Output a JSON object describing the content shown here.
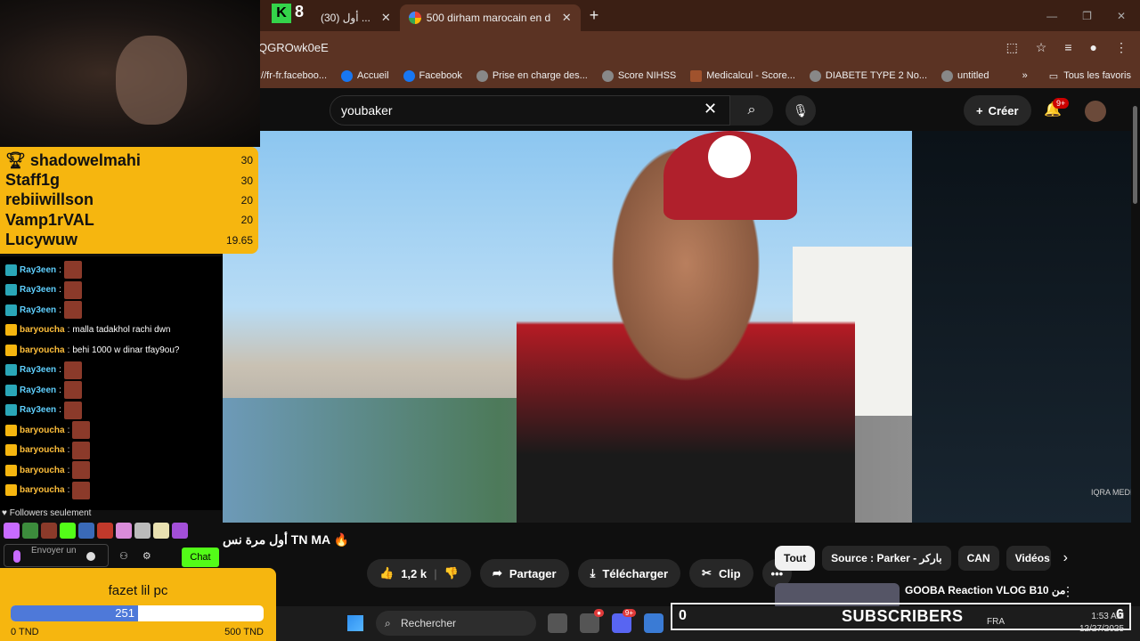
{
  "browser": {
    "tabs": [
      {
        "label": "(30) أول ..."
      },
      {
        "label": "500 dirham marocain en dinar"
      }
    ],
    "url": "QGROwk0eE",
    "bookmarks": [
      {
        "label": "://fr-fr.faceboo..."
      },
      {
        "label": "Accueil"
      },
      {
        "label": "Facebook"
      },
      {
        "label": "Prise en charge des..."
      },
      {
        "label": "Score NIHSS"
      },
      {
        "label": "Medicalcul - Score..."
      },
      {
        "label": "DIABETE TYPE 2 No..."
      },
      {
        "label": "untitled"
      }
    ],
    "favorites_label": "Tous les favoris"
  },
  "youtube": {
    "search_value": "youbaker",
    "create_label": "Créer",
    "notif_badge": "9+",
    "video_title": "أول مرة نس TN MA 🔥",
    "watermark": "IQRA MEDIA",
    "actions": {
      "likes": "1,2 k",
      "share": "Partager",
      "download": "Télécharger",
      "clip": "Clip"
    },
    "chips": [
      "Tout",
      "Source : Parker - باركر",
      "CAN",
      "Vidéos"
    ],
    "rec_title": "GOOBA Reaction VLOG B10 من"
  },
  "overlay": {
    "top_tab_letter": "K",
    "top_tab_count": "8",
    "leaderboard": [
      {
        "name": "shadowelmahi",
        "value": "30",
        "trophy": true
      },
      {
        "name": "Staff1g",
        "value": "30"
      },
      {
        "name": "rebiiwillson",
        "value": "20"
      },
      {
        "name": "Vamp1rVAL",
        "value": "20"
      },
      {
        "name": "Lucywuw",
        "value": "19.65"
      }
    ],
    "chat": [
      {
        "user": "Ray3een",
        "text": "",
        "type": "r"
      },
      {
        "user": "Ray3een",
        "text": "",
        "type": "r"
      },
      {
        "user": "Ray3een",
        "text": "",
        "type": "r"
      },
      {
        "user": "baryoucha",
        "text": "malla tadakhol rachi dwn",
        "type": "b"
      },
      {
        "user": "baryoucha",
        "text": "behi 1000 w dinar tfay9ou?",
        "type": "b"
      },
      {
        "user": "Ray3een",
        "text": "",
        "type": "r"
      },
      {
        "user": "Ray3een",
        "text": "",
        "type": "r"
      },
      {
        "user": "Ray3een",
        "text": "",
        "type": "r"
      },
      {
        "user": "baryoucha",
        "text": "",
        "type": "b"
      },
      {
        "user": "baryoucha",
        "text": "",
        "type": "b"
      },
      {
        "user": "baryoucha",
        "text": "",
        "type": "b"
      },
      {
        "user": "baryoucha",
        "text": "",
        "type": "b"
      }
    ],
    "followers_label": "Followers seulement",
    "chat_placeholder": "Envoyer un",
    "chat_button": "Chat",
    "goal": {
      "title": "fazet lil pc",
      "current": "251",
      "progress": 0.502,
      "min": "0 TND",
      "max": "500 TND"
    }
  },
  "taskbar": {
    "search_label": "Rechercher",
    "subs_label": "SUBSCRIBERS",
    "subs_left": "0",
    "subs_count": "6",
    "lang": "FRA",
    "time": "1:53 AM",
    "date": "12/27/2025"
  }
}
